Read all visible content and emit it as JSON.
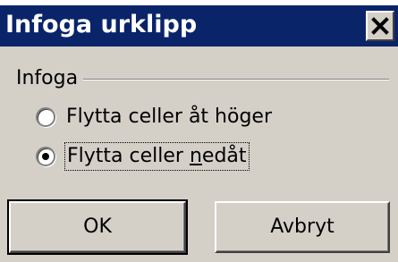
{
  "window": {
    "title": "Infoga urklipp",
    "close_glyph": "✕"
  },
  "group": {
    "label": "Infoga",
    "options": [
      {
        "label": "Flytta celler åt höger",
        "checked": false
      },
      {
        "label_pre": "Flytta celler ",
        "label_u": "n",
        "label_post": "edåt",
        "checked": true
      }
    ]
  },
  "buttons": {
    "ok": "OK",
    "cancel": "Avbryt"
  },
  "colors": {
    "face": "#d4d0c8",
    "titlebar": "#0a246a"
  }
}
